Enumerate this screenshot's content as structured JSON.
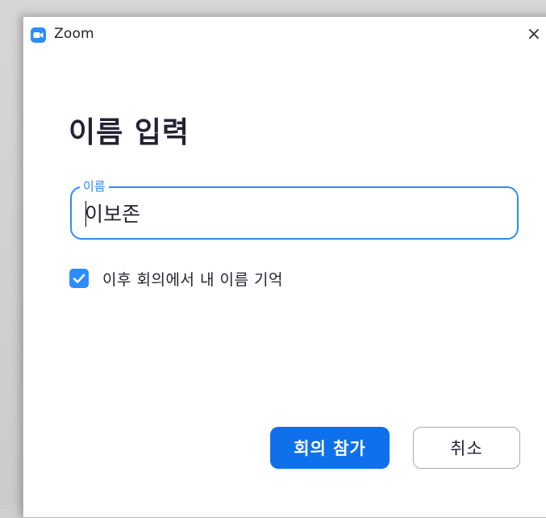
{
  "window": {
    "title": "Zoom",
    "close_symbol": "×"
  },
  "dialog": {
    "heading": "이름 입력",
    "name_field": {
      "label": "이름",
      "value": "이보존"
    },
    "remember_checkbox": {
      "label": "이후 회의에서 내 이름 기억",
      "checked": true
    },
    "buttons": {
      "join_label": "회의 참가",
      "cancel_label": "취소"
    }
  },
  "icons": {
    "app": "zoom-camera-icon",
    "close": "close-icon",
    "check": "checkmark-icon"
  },
  "colors": {
    "accent": "#2d8cff",
    "primary_button": "#0e71eb",
    "text": "#232333"
  }
}
